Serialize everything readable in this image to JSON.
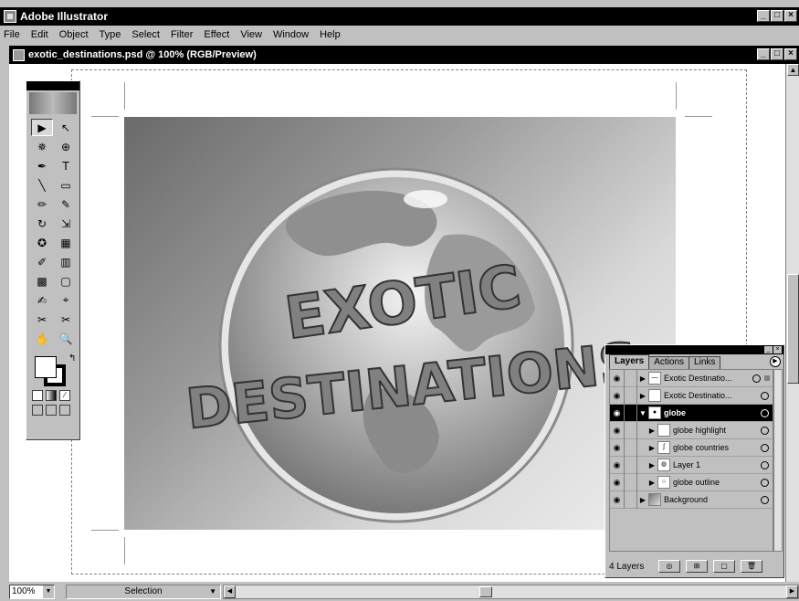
{
  "app": {
    "title": "Adobe Illustrator"
  },
  "window_buttons": [
    "_",
    "□",
    "×"
  ],
  "menu": [
    "File",
    "Edit",
    "Object",
    "Type",
    "Select",
    "Filter",
    "Effect",
    "View",
    "Window",
    "Help"
  ],
  "document": {
    "title": "exotic_destinations.psd @ 100% (RGB/Preview)"
  },
  "artwork": {
    "line1": "EXOTIC",
    "line2": "DESTINATIONS"
  },
  "status": {
    "zoom": "100%",
    "mode": "Selection"
  },
  "toolbox": {
    "tools": [
      "▶",
      "↖",
      "✵",
      "⊕",
      "✒",
      "T",
      "╲",
      "▭",
      "✏",
      "✎",
      "↻",
      "⇲",
      "✪",
      "▦",
      "✐",
      "▥",
      "▩",
      "▢",
      "✍",
      "⌖",
      "✂",
      "✂",
      "✋",
      "🔍"
    ]
  },
  "layers": {
    "tabs": [
      "Layers",
      "Actions",
      "Links"
    ],
    "rows": [
      {
        "name": "Exotic Destinatio...",
        "indent": 0,
        "expanded": false
      },
      {
        "name": "Exotic Destinatio...",
        "indent": 0,
        "expanded": false
      },
      {
        "name": "globe",
        "indent": 0,
        "expanded": true
      },
      {
        "name": "globe highlight",
        "indent": 1,
        "expanded": false
      },
      {
        "name": "globe countries",
        "indent": 1,
        "expanded": false
      },
      {
        "name": "Layer 1",
        "indent": 1,
        "expanded": false
      },
      {
        "name": "globe outline",
        "indent": 1,
        "expanded": false
      },
      {
        "name": "Background",
        "indent": 0,
        "expanded": false
      }
    ],
    "count": "4 Layers"
  },
  "colors": {
    "title_bg": "#000000",
    "chrome": "#c0c0c0",
    "canvas": "#ffffff",
    "text_fill": "#808080"
  }
}
